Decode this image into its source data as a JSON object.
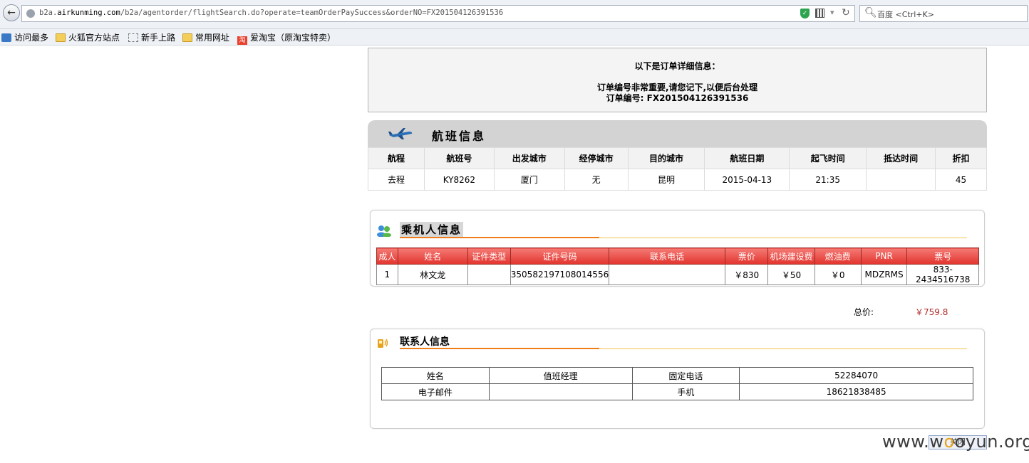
{
  "browser": {
    "url_host": "b2a.airkunming.com",
    "url_prefix": "b2a.",
    "url_host_main": "airkunming.com",
    "url_path": "/b2a/agentorder/flightSearch.do?operate=teamOrderPaySuccess&orderNO=FX201504126391536",
    "search_placeholder": "百度 <Ctrl+K>",
    "bookmarks": [
      "访问最多",
      "火狐官方站点",
      "新手上路",
      "常用网址",
      "爱淘宝（原淘宝特卖）"
    ],
    "taobao_glyph": "淘"
  },
  "order": {
    "heading": "以下是订单详细信息：",
    "note": "订单编号非常重要,请您记下,以便后台处理",
    "number_line": "订单编号: FX201504126391536"
  },
  "flight": {
    "title": "航班信息",
    "headers": [
      "航程",
      "航班号",
      "出发城市",
      "经停城市",
      "目的城市",
      "航班日期",
      "起飞时间",
      "抵达时间",
      "折扣"
    ],
    "rows": [
      [
        "去程",
        "KY8262",
        "厦门",
        "无",
        "昆明",
        "2015-04-13",
        "21:35",
        "",
        "45"
      ]
    ]
  },
  "passengers": {
    "title": "乘机人信息",
    "headers": [
      "成人",
      "姓名",
      "证件类型",
      "证件号码",
      "联系电话",
      "票价",
      "机场建设费",
      "燃油费",
      "PNR",
      "票号"
    ],
    "rows": [
      [
        "1",
        "林文龙",
        "",
        "350582197108014556",
        "",
        "￥830",
        "￥50",
        "￥0",
        "MDZRMS",
        "833-2434516738"
      ]
    ]
  },
  "total": {
    "label": "总价:",
    "value": "￥759.8"
  },
  "contact": {
    "title": "联系人信息",
    "rows": [
      [
        "姓名",
        "值班经理",
        "固定电话",
        "52284070"
      ],
      [
        "电子邮件",
        "",
        "手机",
        "18621838485"
      ]
    ]
  },
  "close_label": "关闭",
  "watermark": {
    "pre": "www.w",
    "o": "o",
    "post": "oyun.org"
  },
  "colors": {
    "table_header_red": "#e2342e",
    "accent_orange": "#f07c1a",
    "price_red": "#b12a2a",
    "panel_grey": "#d3d3d3"
  }
}
